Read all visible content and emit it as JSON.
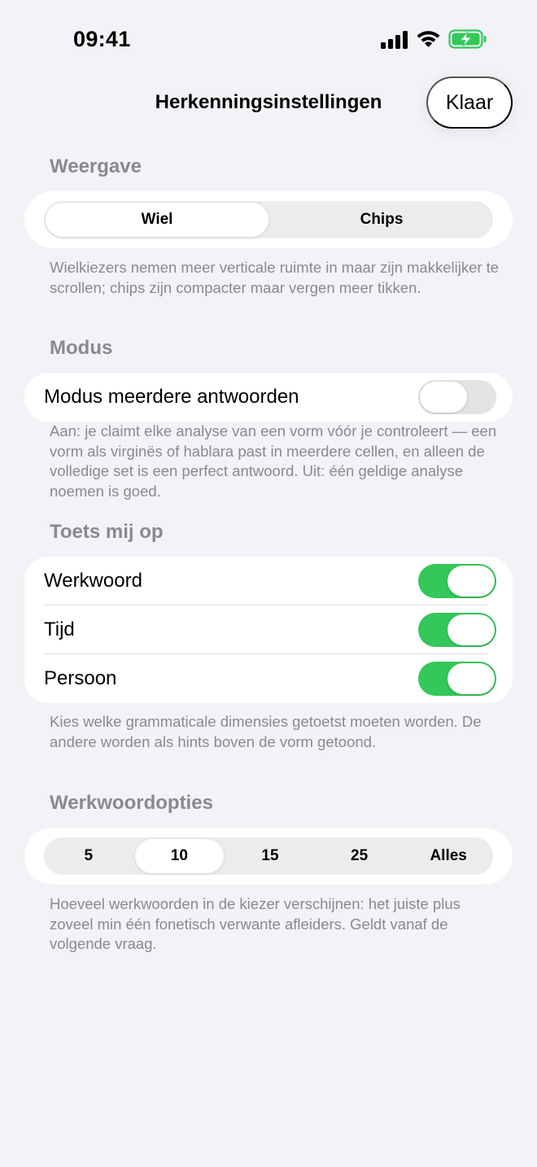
{
  "status_bar": {
    "time": "09:41"
  },
  "nav": {
    "title": "Herkenningsinstellingen",
    "done_label": "Klaar"
  },
  "display": {
    "header": "Weergave",
    "options": [
      "Wiel",
      "Chips"
    ],
    "selected": "Wiel",
    "footer": "Wielkiezers nemen meer verticale ruimte in maar zijn makkelijker te scrollen; chips zijn compacter maar vergen meer tikken."
  },
  "mode": {
    "header": "Modus",
    "row_label": "Modus meerdere antwoorden",
    "enabled": false,
    "footer": "Aan: je claimt elke analyse van een vorm vóór je controleert — een vorm als virginës of hablara past in meerdere cellen, en alleen de volledige set is een perfect antwoord. Uit: één geldige analyse noemen is goed."
  },
  "quiz": {
    "header": "Toets mij op",
    "rows": [
      {
        "label": "Werkwoord",
        "enabled": true
      },
      {
        "label": "Tijd",
        "enabled": true
      },
      {
        "label": "Persoon",
        "enabled": true
      }
    ],
    "footer": "Kies welke grammaticale dimensies getoetst moeten worden. De andere worden als hints boven de vorm getoond."
  },
  "verb_options": {
    "header": "Werkwoordopties",
    "options": [
      "5",
      "10",
      "15",
      "25",
      "Alles"
    ],
    "selected": "10",
    "footer": "Hoeveel werkwoorden in de kiezer verschijnen: het juiste plus zoveel min één fonetisch verwante afleiders. Geldt vanaf de volgende vraag."
  },
  "colors": {
    "toggle_on": "#34c759",
    "background": "#f2f2f7",
    "secondary_text": "#8a8a8e"
  }
}
